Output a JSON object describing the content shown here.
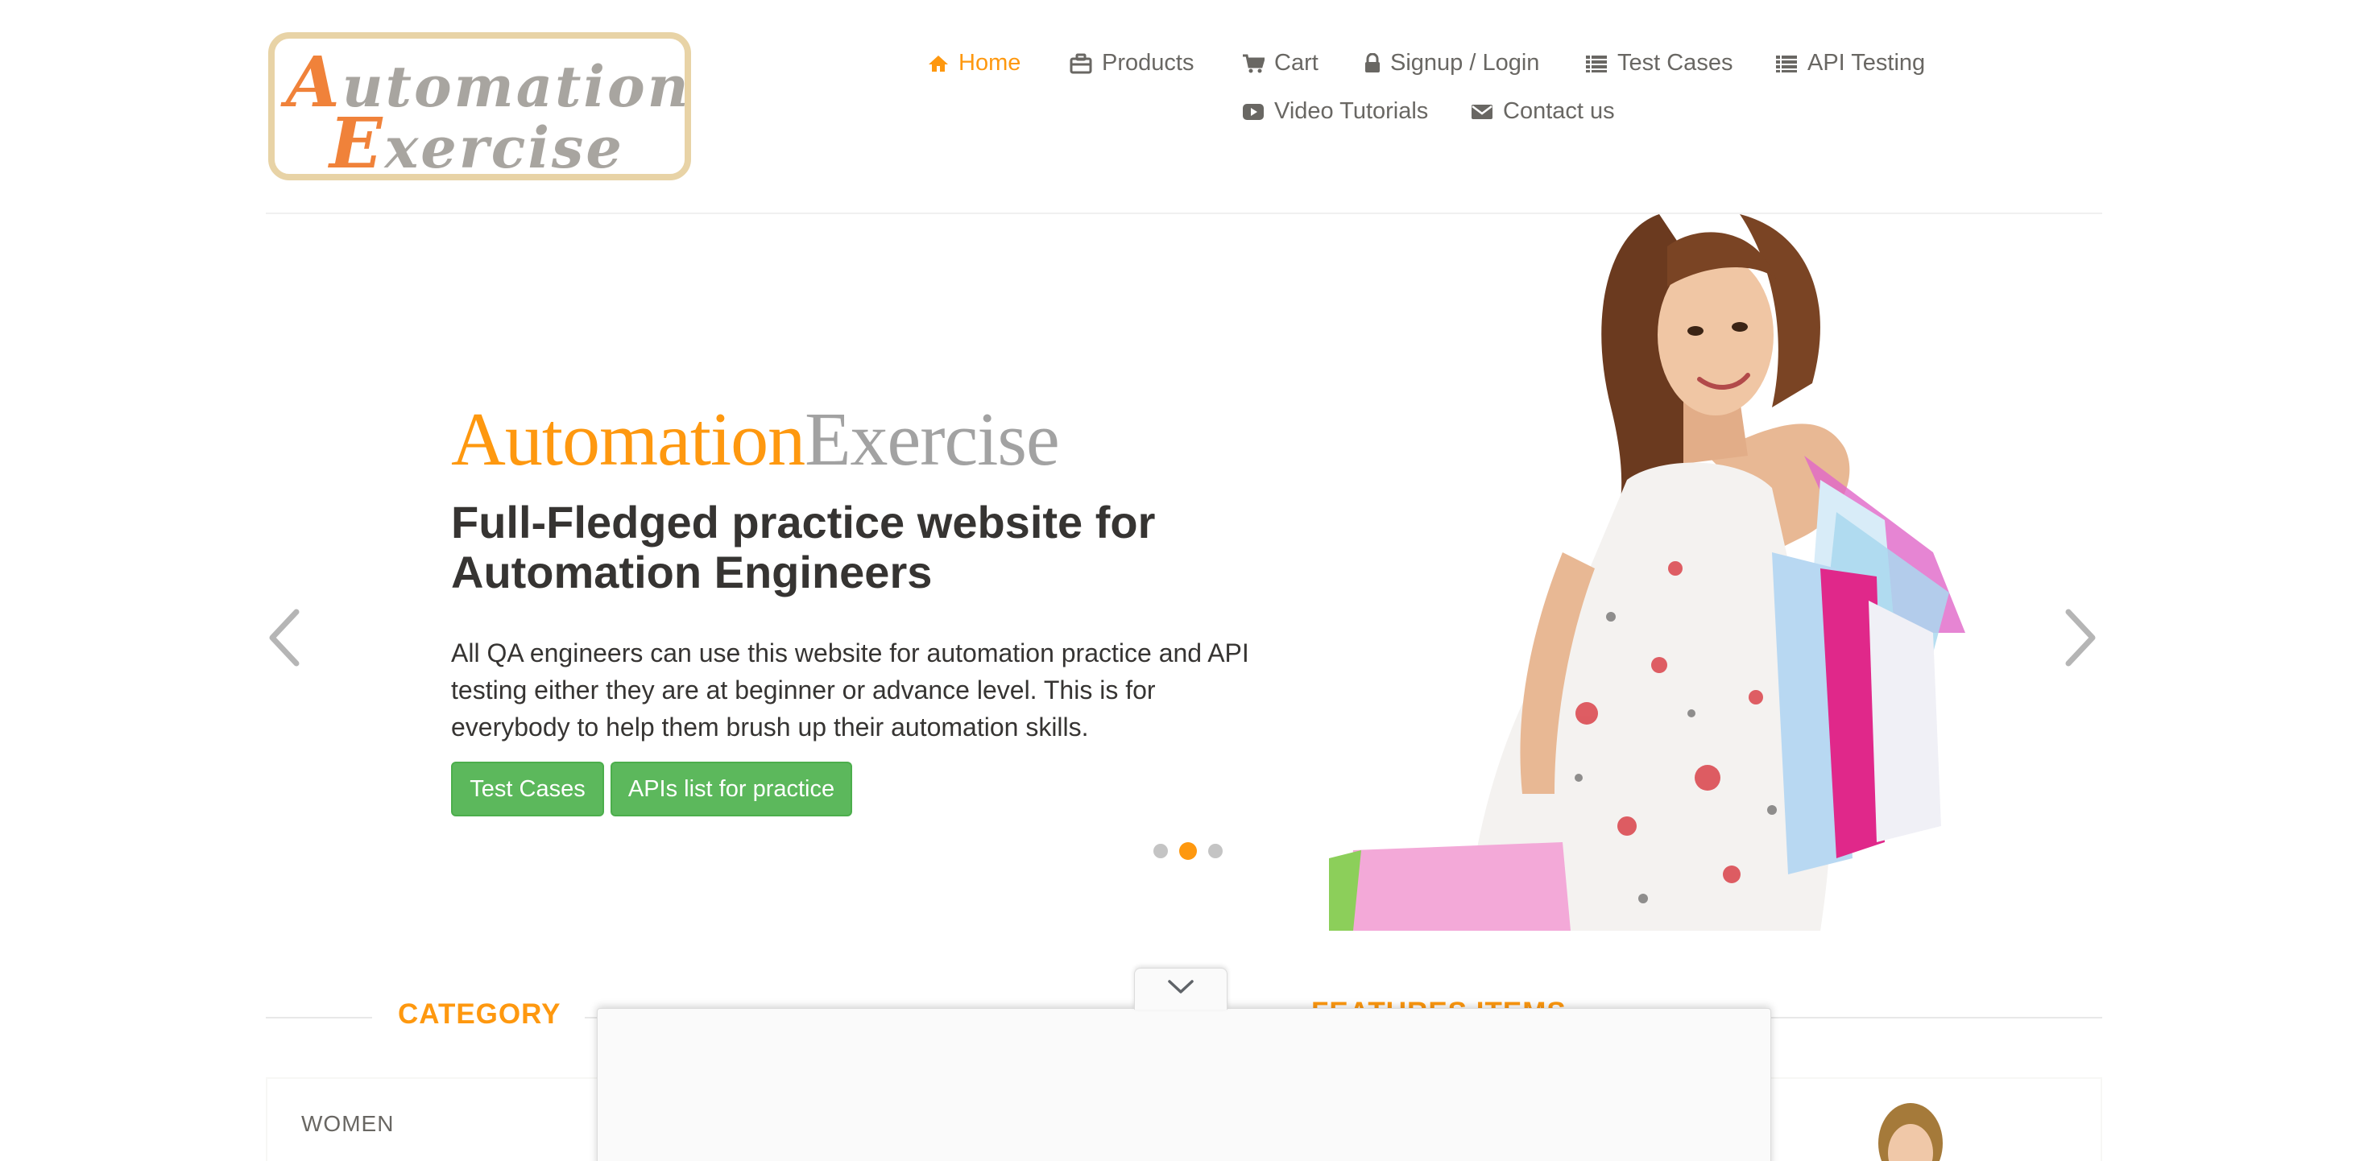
{
  "header": {
    "logo_text": "Automation Exercise",
    "nav": [
      {
        "label": "Home",
        "icon": "home-icon",
        "active": true
      },
      {
        "label": "Products",
        "icon": "briefcase-icon"
      },
      {
        "label": "Cart",
        "icon": "cart-icon"
      },
      {
        "label": "Signup / Login",
        "icon": "lock-icon"
      },
      {
        "label": "Test Cases",
        "icon": "list-icon"
      },
      {
        "label": "API Testing",
        "icon": "list-icon"
      },
      {
        "label": "Video Tutorials",
        "icon": "youtube-play-icon"
      },
      {
        "label": "Contact us",
        "icon": "envelope-icon"
      }
    ]
  },
  "slider": {
    "brand_part1": "Automation",
    "brand_part2": "Exercise",
    "heading": "Full-Fledged practice website for Automation Engineers",
    "text": "All QA engineers can use this website for automation practice and API testing either they are at beginner or advance level. This is for everybody to help them brush up their automation skills.",
    "buttons": [
      "Test Cases",
      "APIs list for practice"
    ],
    "active_slide": 2,
    "slide_count": 3
  },
  "sections": {
    "category_title": "CATEGORY",
    "features_title": "FEATURES ITEMS",
    "categories": [
      "WOMEN"
    ]
  },
  "colors": {
    "accent": "#fe980f",
    "button_green": "#5cb85c",
    "text_dark": "#363432",
    "text_gray": "#696763"
  }
}
